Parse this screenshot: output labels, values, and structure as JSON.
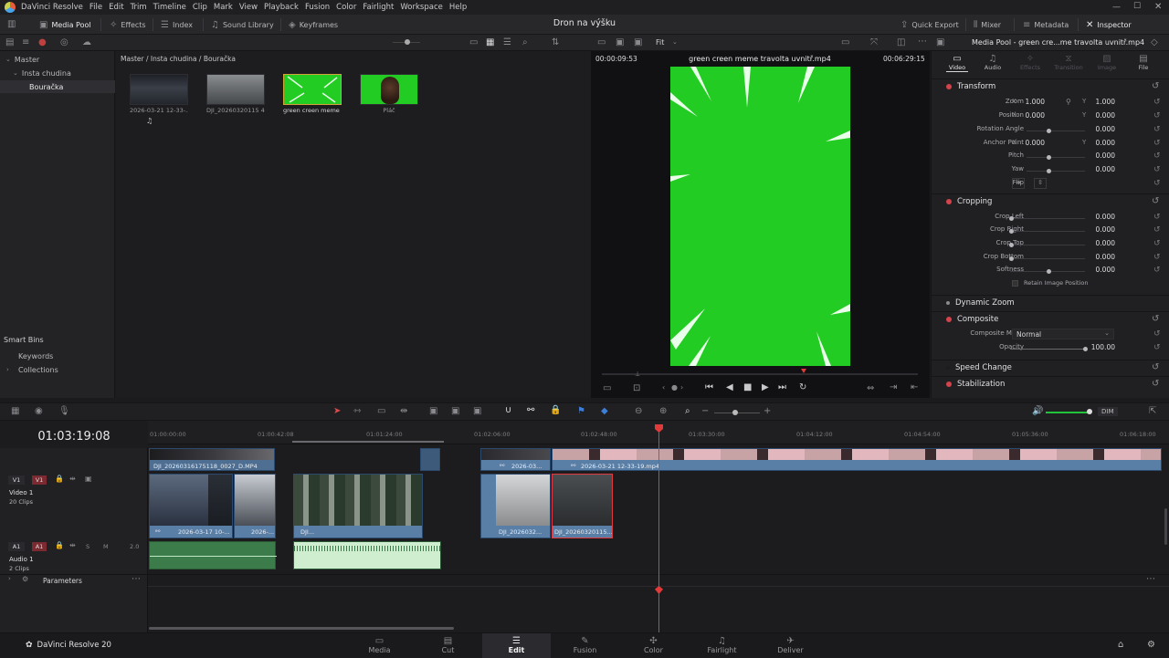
{
  "menu": {
    "app": "DaVinci Resolve",
    "items": [
      "File",
      "Edit",
      "Trim",
      "Timeline",
      "Clip",
      "Mark",
      "View",
      "Playback",
      "Fusion",
      "Color",
      "Fairlight",
      "Workspace",
      "Help"
    ]
  },
  "project_title": "Dron na výšku",
  "toolbar": {
    "media_pool": "Media Pool",
    "effects": "Effects",
    "index": "Index",
    "sound_library": "Sound Library",
    "keyframes": "Keyframes",
    "quick_export": "Quick Export",
    "mixer": "Mixer",
    "metadata": "Metadata",
    "inspector": "Inspector"
  },
  "bins": {
    "master": "Master",
    "folder": "Insta chudina",
    "active": "Bouračka",
    "smart_bins": "Smart Bins",
    "keywords": "Keywords",
    "collections": "Collections"
  },
  "pool": {
    "path": "Master / Insta chudina / Bouračka",
    "clips": [
      {
        "label": "2026-03-21 12-33-...",
        "color": "#2a2d33"
      },
      {
        "label": "DJI_20260320115 4...",
        "color": "#6b6e72"
      },
      {
        "label": "green creen meme ...",
        "color": "#22cc22"
      },
      {
        "label": "Pláč",
        "color": "#22cc22"
      }
    ]
  },
  "viewer": {
    "zoom": "Fit",
    "left_tc": "00:00:09:53",
    "clip_name": "green creen meme travolta uvnitř.mp4",
    "right_tc": "00:06:29:15"
  },
  "inspector": {
    "header": "Media Pool - green cre...me travolta uvnitř.mp4",
    "tabs": [
      "Video",
      "Audio",
      "Effects",
      "Transition",
      "Image",
      "File"
    ],
    "transform": "Transform",
    "zoom_label": "Zoom",
    "zoom_x": "1.000",
    "zoom_y": "1.000",
    "position_label": "Position",
    "pos_x": "0.000",
    "pos_y": "0.000",
    "rotation_label": "Rotation Angle",
    "rotation": "0.000",
    "anchor_label": "Anchor Point",
    "anchor_x": "0.000",
    "anchor_y": "0.000",
    "pitch_label": "Pitch",
    "pitch": "0.000",
    "yaw_label": "Yaw",
    "yaw": "0.000",
    "flip_label": "Flip",
    "cropping": "Cropping",
    "crop_left_label": "Crop Left",
    "crop_left": "0.000",
    "crop_right_label": "Crop Right",
    "crop_right": "0.000",
    "crop_top_label": "Crop Top",
    "crop_top": "0.000",
    "crop_bottom_label": "Crop Bottom",
    "crop_bottom": "0.000",
    "softness_label": "Softness",
    "softness": "0.000",
    "retain_label": "Retain Image Position",
    "dynamic_zoom": "Dynamic Zoom",
    "composite": "Composite",
    "composite_mode_label": "Composite Mode",
    "composite_mode": "Normal",
    "opacity_label": "Opacity",
    "opacity": "100.00",
    "speed_change": "Speed Change",
    "stabilization": "Stabilization"
  },
  "edit_toolbar": {
    "dim": "DIM"
  },
  "timeline": {
    "timecode": "01:03:19:08",
    "ruler": [
      "01:00:00:00",
      "01:00:42:08",
      "01:01:24:00",
      "01:02:06:00",
      "01:02:48:00",
      "01:03:30:00",
      "01:04:12:00",
      "01:04:54:00",
      "01:05:36:00",
      "01:06:18:00"
    ],
    "v1_tag": "V1",
    "v1_name": "Video 1",
    "v1_count": "20 Clips",
    "a1_tag": "A1",
    "a1_name": "Audio 1",
    "a1_count": "2 Clips",
    "a1_level": "2.0",
    "solo": "S",
    "mute": "M",
    "parameters": "Parameters",
    "clip_upper_1": "DJI_20260316175118_0027_D.MP4",
    "clip_upper_2": "2026-03...",
    "clip_upper_3": "2026-03-21 12-33-19.mp4",
    "clip_v_1": "2026-03-17 10-...",
    "clip_v_2": "2026-...",
    "clip_v_3": "DJI...",
    "clip_v_4": "DJI_2026032...",
    "clip_v_5": "DJI_20260320115..."
  },
  "pages": [
    "Media",
    "Cut",
    "Edit",
    "Fusion",
    "Color",
    "Fairlight",
    "Deliver"
  ],
  "active_page": "Edit",
  "brand": "DaVinci Resolve 20"
}
